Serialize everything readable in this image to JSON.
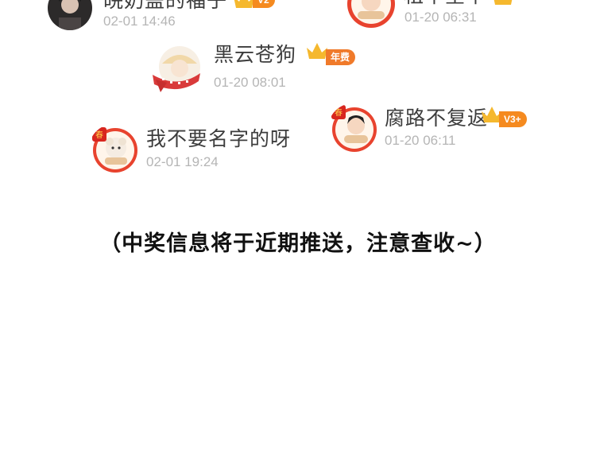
{
  "entries": [
    {
      "name": "皖奶盖的福子",
      "time": "02-01 14:46",
      "badge": "V2",
      "badge_color": "#f58a1f"
    },
    {
      "name": "租中星平",
      "time": "01-20 06:31",
      "badge": "",
      "badge_color": "#f58a1f"
    },
    {
      "name": "黑云苍狗",
      "time": "01-20 08:01",
      "badge": "年费",
      "badge_color": "#f07a2a"
    },
    {
      "name": "腐路不复返",
      "time": "01-20 06:11",
      "badge": "V3+",
      "badge_color": "#f58a1f"
    },
    {
      "name": "我不要名字的呀",
      "time": "02-01 19:24",
      "badge": "",
      "badge_color": "#f58a1f"
    }
  ],
  "notice": "（中奖信息将于近期推送，注意查收~）",
  "colors": {
    "name": "#3d3d3d",
    "time": "#b5b5b5",
    "crown": "#f5b82e",
    "frame": "#e8432e"
  }
}
